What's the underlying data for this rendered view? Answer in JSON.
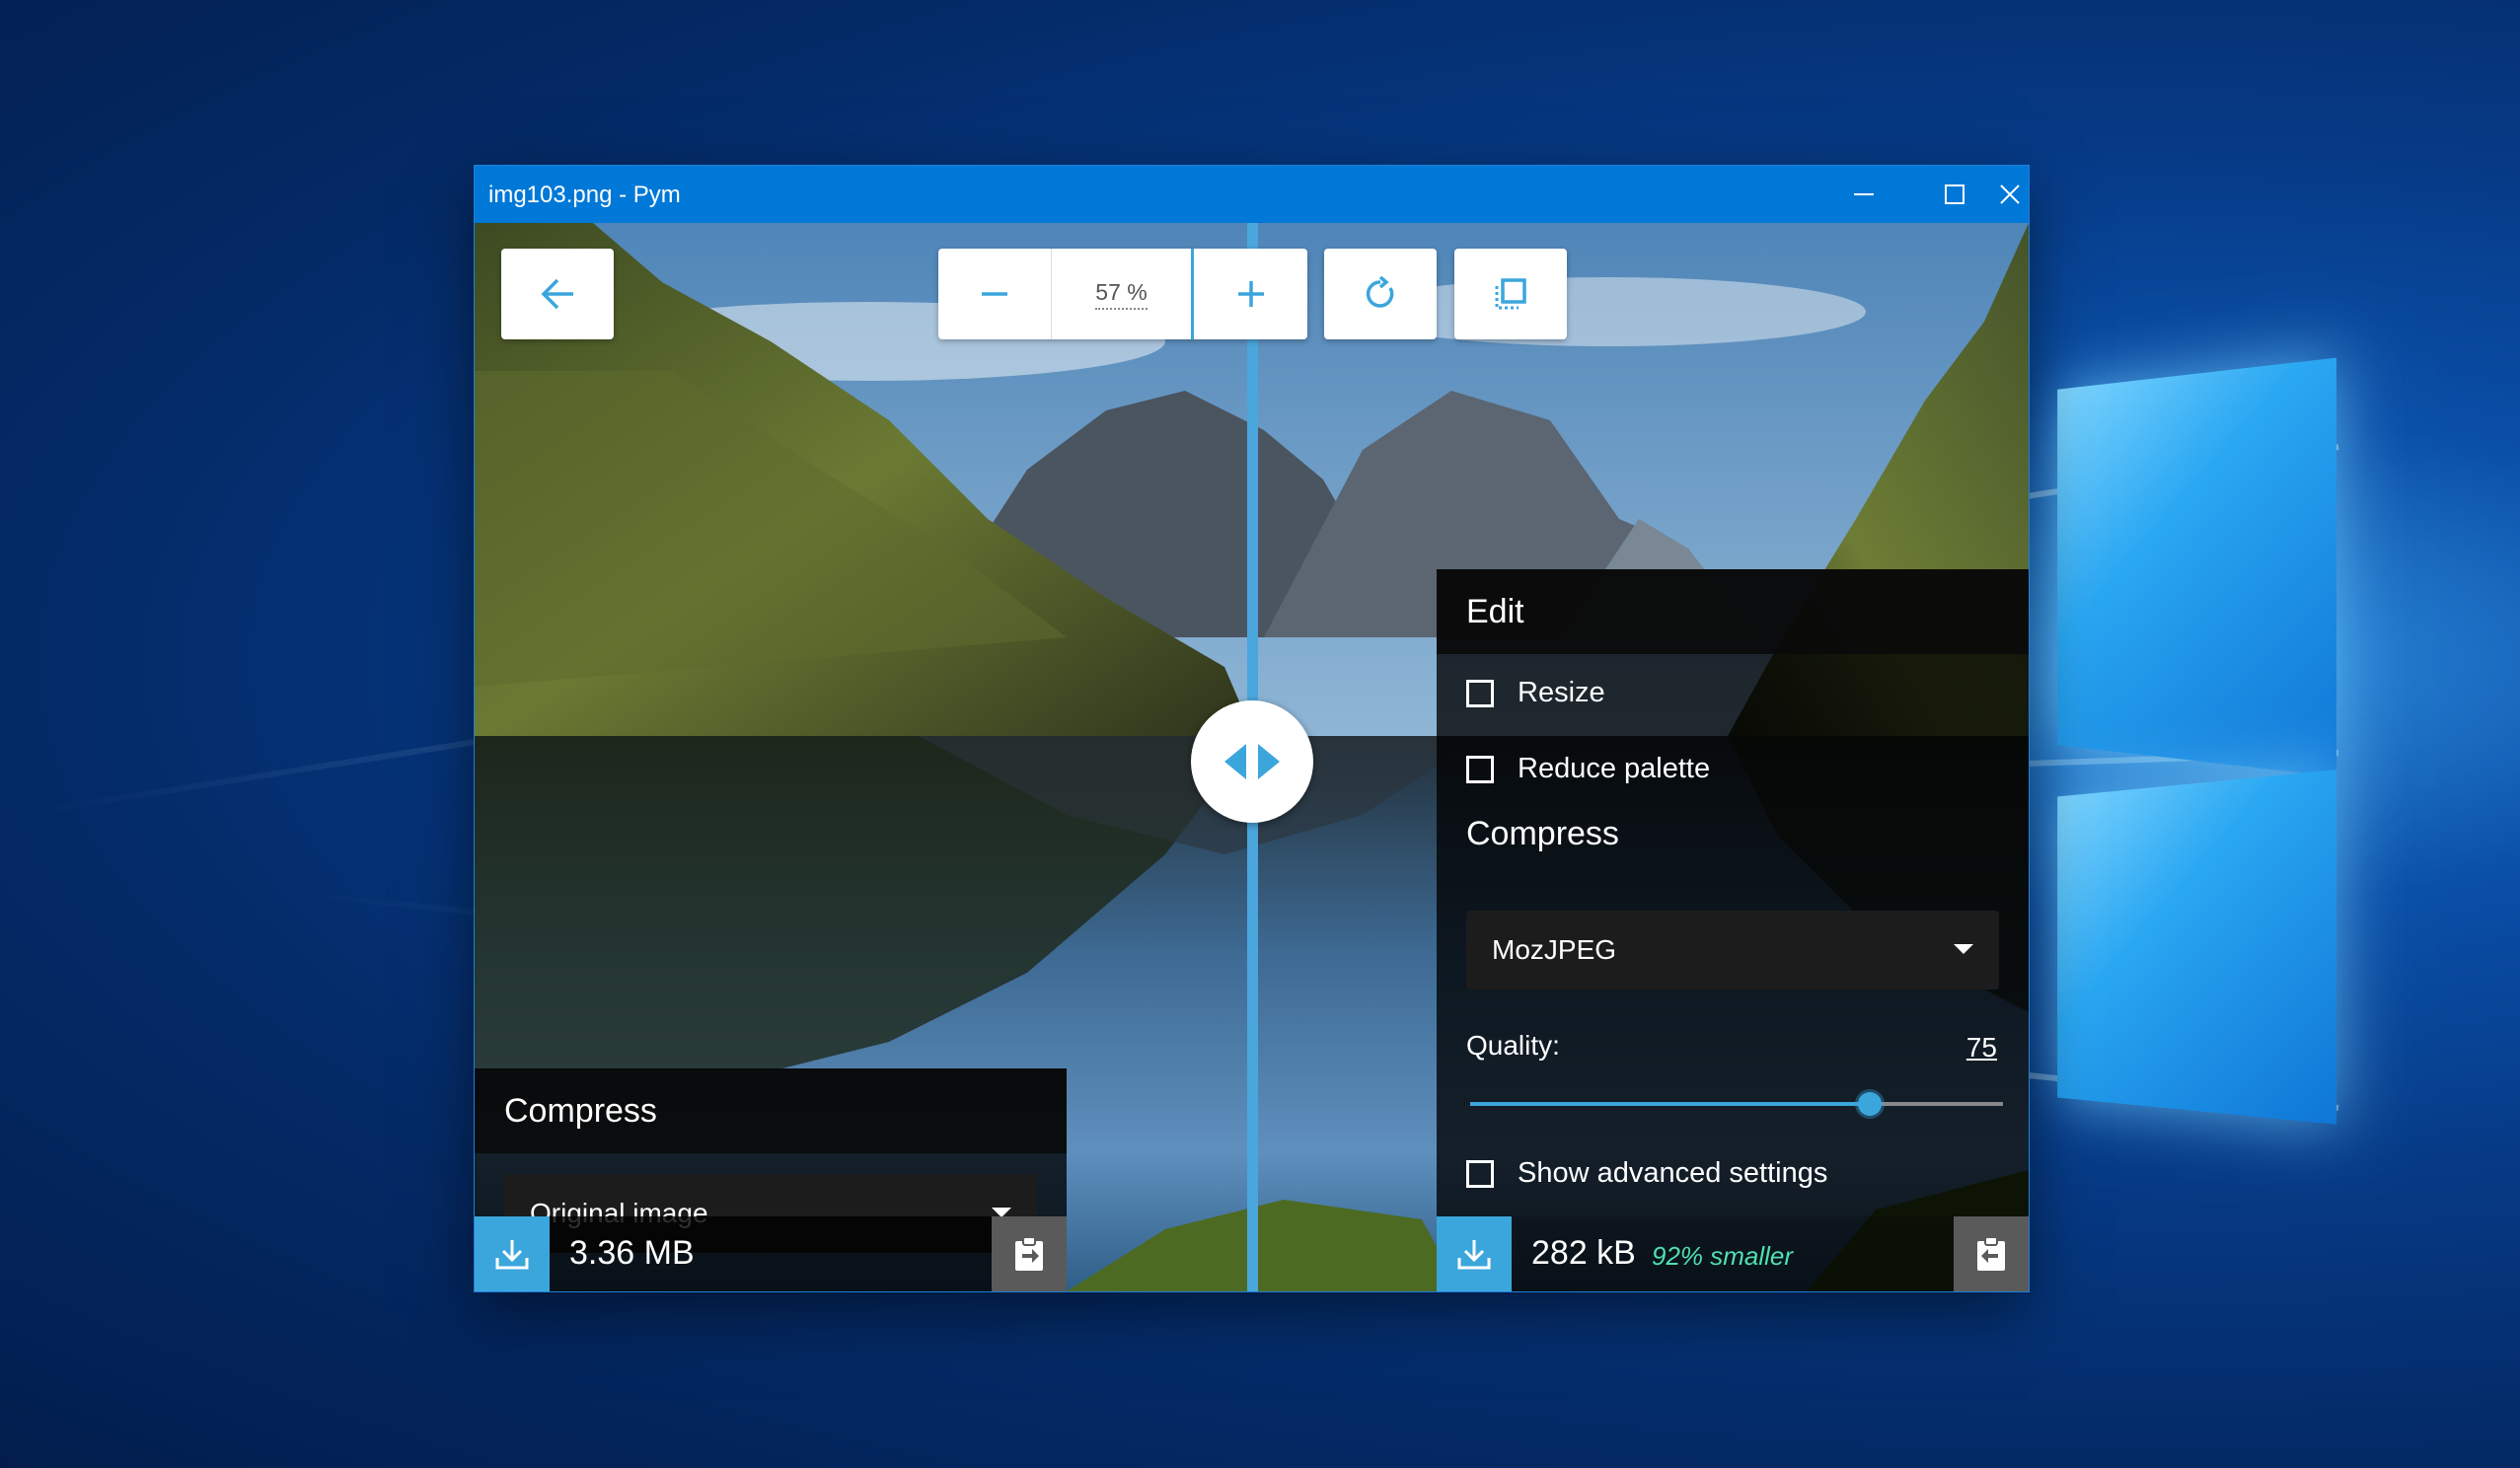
{
  "window": {
    "title": "img103.png - Pym"
  },
  "toolbar": {
    "zoom_value": "57 %"
  },
  "left_panel": {
    "heading": "Compress",
    "method_selected": "Original image",
    "file_size": "3.36 MB"
  },
  "right_panel": {
    "edit_heading": "Edit",
    "resize_label": "Resize",
    "resize_checked": false,
    "reduce_palette_label": "Reduce palette",
    "reduce_palette_checked": false,
    "compress_heading": "Compress",
    "method_selected": "MozJPEG",
    "quality_label": "Quality:",
    "quality_value": "75",
    "quality_level": 0.75,
    "advanced_label": "Show advanced settings",
    "advanced_checked": false,
    "file_size": "282 kB",
    "size_reduction": "92% smaller"
  },
  "colors": {
    "accent": "#3ba6dc",
    "titlebar": "#0078d7",
    "reduction_text": "#4fe0b0"
  },
  "icons": [
    "back-arrow-icon",
    "minus-icon",
    "plus-icon",
    "rotate-icon",
    "fit-screen-icon",
    "compare-arrows-icon",
    "download-icon",
    "paste-icon",
    "minimize-icon",
    "maximize-icon",
    "close-icon"
  ]
}
